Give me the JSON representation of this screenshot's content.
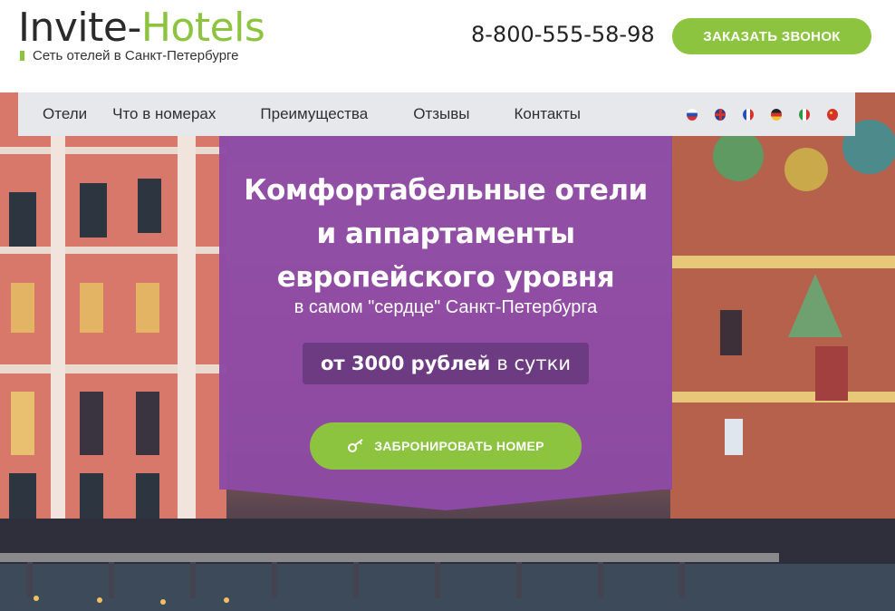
{
  "header": {
    "logo_part1": "Invite-",
    "logo_part2": "Hotels",
    "tagline": "Сеть отелей в Санкт-Петербурге",
    "phone": "8-800-555-58-98",
    "callback_label": "ЗАКАЗАТЬ ЗВОНОК"
  },
  "nav": {
    "items": [
      {
        "label": "Отели"
      },
      {
        "label": "Что в номерах"
      },
      {
        "label": "Преимущества"
      },
      {
        "label": "Отзывы"
      },
      {
        "label": "Контакты"
      }
    ]
  },
  "languages": [
    {
      "icon": "russia-flag-icon"
    },
    {
      "icon": "uk-flag-icon"
    },
    {
      "icon": "france-flag-icon"
    },
    {
      "icon": "germany-flag-icon"
    },
    {
      "icon": "italy-flag-icon"
    },
    {
      "icon": "china-flag-icon"
    }
  ],
  "hero": {
    "title_line1": "Комфортабельные отели",
    "title_line2": "и аппартаменты",
    "title_line3": "европейского уровня",
    "subtitle": "в самом \"сердце\" Санкт-Петербурга",
    "price_bold": "от 3000 рублей",
    "price_rest": "в сутки",
    "book_label": "ЗАБРОНИРОВАТЬ НОМЕР"
  },
  "colors": {
    "accent_green": "#8cc43f",
    "panel_purple": "#8d4aa4",
    "price_purple": "#6c3b82",
    "nav_bg": "#e6e8eb"
  }
}
